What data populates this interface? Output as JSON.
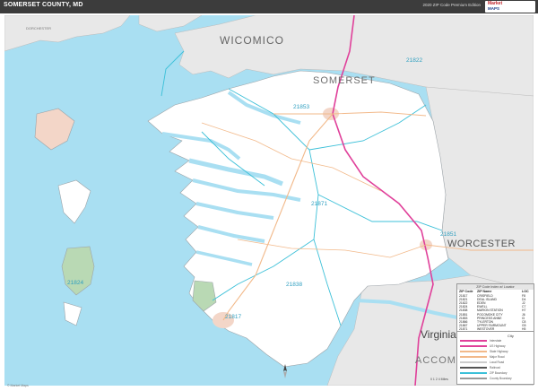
{
  "header": {
    "title": "SOMERSET COUNTY, MD",
    "subtitle": "2020 ZIP Code Premium Edition",
    "logo_top": "Market",
    "logo_bottom": "MAPS"
  },
  "colors": {
    "water": "#a9dff2",
    "land": "#ffffff",
    "neighbor_land": "#e8e8e8",
    "zip_boundary": "#3cc0d8",
    "highway": "#e0409a",
    "road": "#f2b98a",
    "urban": "#f3d6c8",
    "park": "#b9d9b4"
  },
  "region_labels": {
    "wicomico": "WICOMICO",
    "somerset": "SOMERSET",
    "worcester": "WORCESTER",
    "virginia": "Virginia",
    "accomac": "ACCOMAC",
    "dorchester": "DORCHESTER"
  },
  "zip_labels": {
    "z21853": "21853",
    "z21822": "21822",
    "z21871": "21871",
    "z21838": "21838",
    "z21851": "21851",
    "z21824": "21824",
    "z21817": "21817"
  },
  "legend": {
    "title": "ZIP Code Index w/ Locator",
    "headers": {
      "zip": "ZIP Code",
      "name": "ZIP Name",
      "loc": "LOC"
    },
    "rows": [
      {
        "zip": "21817",
        "name": "CRISFIELD",
        "loc": "F8"
      },
      {
        "zip": "21821",
        "name": "DEAL ISLAND",
        "loc": "D4"
      },
      {
        "zip": "21822",
        "name": "EDEN",
        "loc": "J2"
      },
      {
        "zip": "21824",
        "name": "EWELL",
        "loc": "C7"
      },
      {
        "zip": "21838",
        "name": "MARION STATION",
        "loc": "H7"
      },
      {
        "zip": "21851",
        "name": "POCOMOKE CITY",
        "loc": "J6"
      },
      {
        "zip": "21853",
        "name": "PRINCESS ANNE",
        "loc": "I3"
      },
      {
        "zip": "21866",
        "name": "TYLERTON",
        "loc": "C8"
      },
      {
        "zip": "21867",
        "name": "UPPER FAIRMOUNT",
        "loc": "G5"
      },
      {
        "zip": "21871",
        "name": "WESTOVER",
        "loc": "H5"
      }
    ]
  },
  "key": {
    "city_label": "City",
    "items": [
      {
        "label": "Interstate"
      },
      {
        "label": "US Highway"
      },
      {
        "label": "State Highway"
      },
      {
        "label": "Major Road"
      },
      {
        "label": "Local Road"
      },
      {
        "label": "Railroad"
      },
      {
        "label": "ZIP Boundary"
      },
      {
        "label": "County Boundary"
      }
    ]
  },
  "scale": {
    "label": "0 1 2 4 Miles"
  },
  "copyright": "© Market Maps"
}
